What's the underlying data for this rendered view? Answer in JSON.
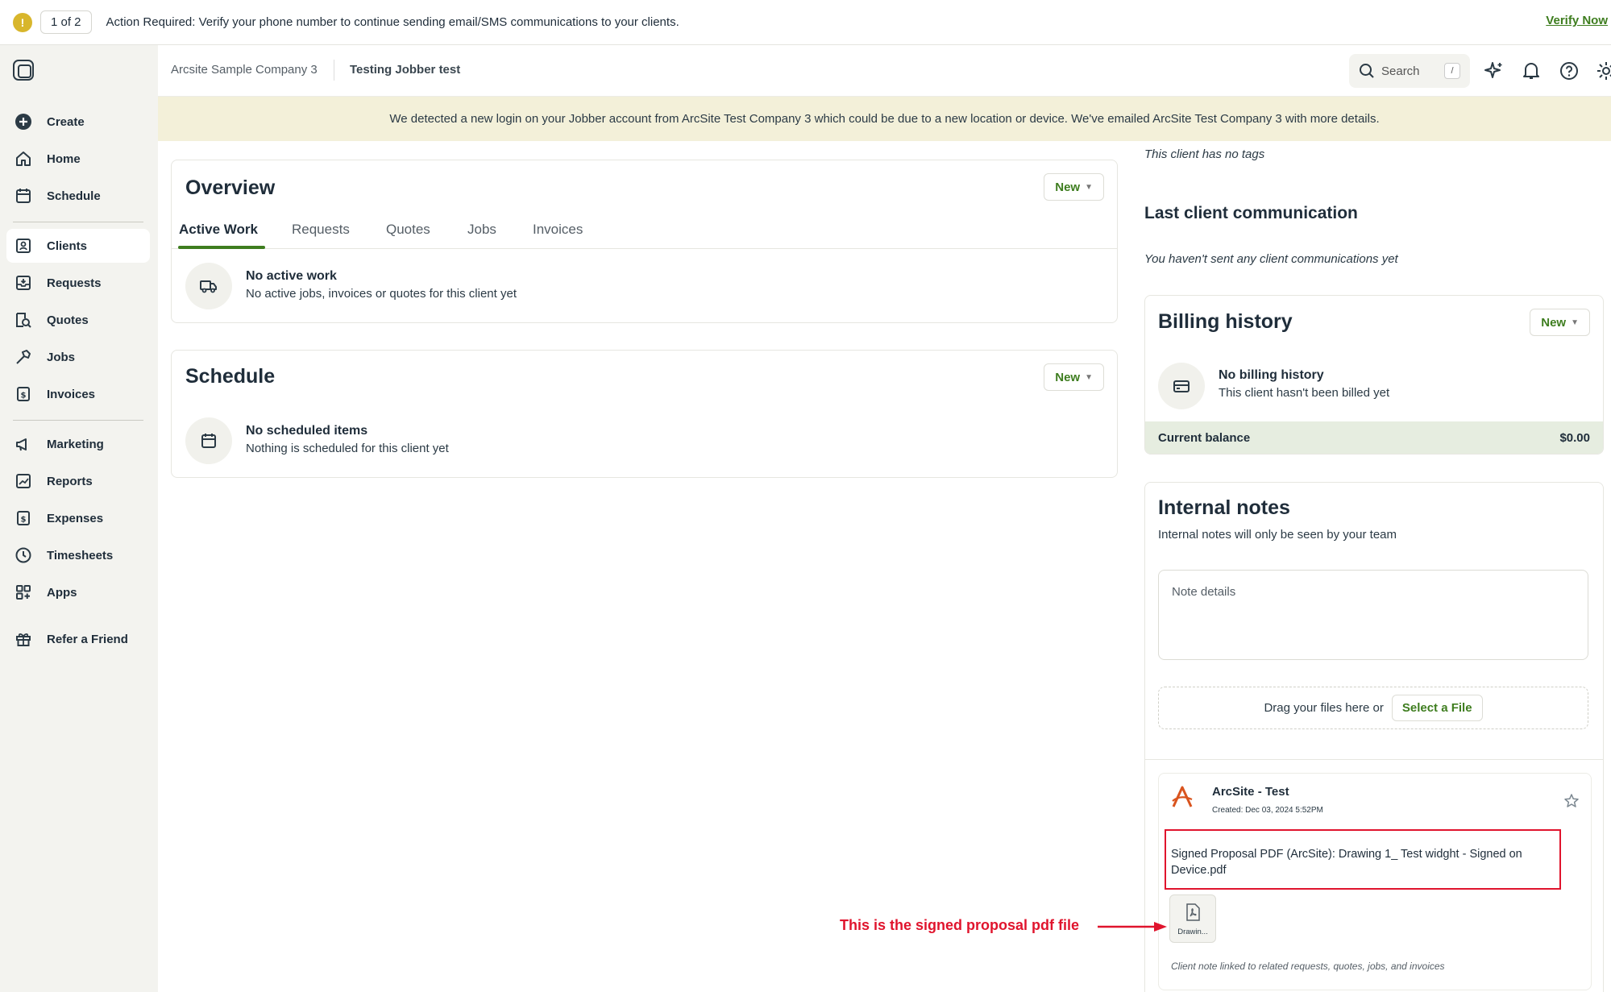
{
  "action_bar": {
    "counter": "1 of 2",
    "message": "Action Required: Verify your phone number to continue sending email/SMS communications to your clients.",
    "verify": "Verify Now"
  },
  "sidebar": {
    "items": [
      {
        "label": "Create",
        "icon": "plus-circle-icon"
      },
      {
        "label": "Home",
        "icon": "home-icon"
      },
      {
        "label": "Schedule",
        "icon": "calendar-icon"
      },
      {
        "label": "Clients",
        "icon": "clients-icon"
      },
      {
        "label": "Requests",
        "icon": "inbox-icon"
      },
      {
        "label": "Quotes",
        "icon": "quote-icon"
      },
      {
        "label": "Jobs",
        "icon": "hammer-icon"
      },
      {
        "label": "Invoices",
        "icon": "invoice-icon"
      },
      {
        "label": "Marketing",
        "icon": "megaphone-icon"
      },
      {
        "label": "Reports",
        "icon": "chart-icon"
      },
      {
        "label": "Expenses",
        "icon": "expense-icon"
      },
      {
        "label": "Timesheets",
        "icon": "clock-icon"
      },
      {
        "label": "Apps",
        "icon": "apps-icon"
      },
      {
        "label": "Refer a Friend",
        "icon": "gift-icon"
      }
    ],
    "active": "Clients"
  },
  "header": {
    "company": "Arcsite Sample Company 3",
    "client": "Testing Jobber test",
    "search_placeholder": "Search",
    "search_shortcut": "/"
  },
  "notice": "We detected a new login on your Jobber account from ArcSite Test Company 3 which could be due to a new location or device. We've emailed ArcSite Test Company 3 with more details.",
  "overview": {
    "title": "Overview",
    "new_label": "New",
    "tabs": [
      "Active Work",
      "Requests",
      "Quotes",
      "Jobs",
      "Invoices"
    ],
    "empty_title": "No active work",
    "empty_sub": "No active jobs, invoices or quotes for this client yet"
  },
  "schedule": {
    "title": "Schedule",
    "new_label": "New",
    "empty_title": "No scheduled items",
    "empty_sub": "Nothing is scheduled for this client yet"
  },
  "tags_text": "This client has no tags",
  "last_comm": {
    "title": "Last client communication",
    "text": "You haven't sent any client communications yet"
  },
  "billing": {
    "title": "Billing history",
    "new_label": "New",
    "empty_title": "No billing history",
    "empty_sub": "This client hasn't been billed yet",
    "balance_label": "Current balance",
    "balance_value": "$0.00"
  },
  "notes": {
    "title": "Internal notes",
    "subtitle": "Internal notes will only be seen by your team",
    "placeholder": "Note details",
    "drop_text": "Drag your files here or",
    "select_file": "Select a File",
    "note_author": "ArcSite - Test",
    "note_created": "Created: Dec 03, 2024 5:52PM",
    "note_body": "Signed Proposal PDF (ArcSite): Drawing 1_ Test widght - Signed on Device.pdf",
    "attachment_name": "Drawin...",
    "footer": "Client note linked to related requests, quotes, jobs, and invoices"
  },
  "annotation": {
    "text": "This is the signed proposal pdf file",
    "color": "#e0142d"
  },
  "colors": {
    "brand_green": "#3e7d1f",
    "sidebar_bg": "#f3f3ef",
    "notice_bg": "#f3f0d9",
    "balance_bg": "#e6ede0"
  }
}
